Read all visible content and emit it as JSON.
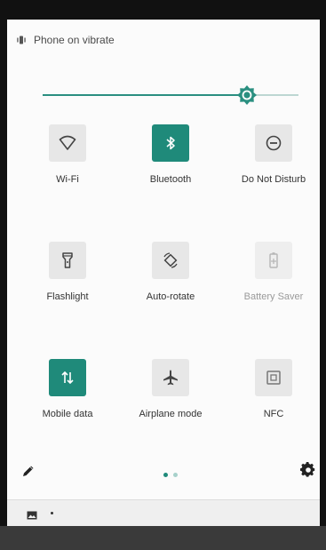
{
  "status": {
    "text": "Phone on vibrate",
    "icon": "vibrate-icon"
  },
  "brightness": {
    "level_fraction": 0.8
  },
  "tiles": [
    {
      "label": "Wi-Fi",
      "icon": "wifi-icon",
      "state": "off"
    },
    {
      "label": "Bluetooth",
      "icon": "bluetooth-icon",
      "state": "on"
    },
    {
      "label": "Do Not Disturb",
      "icon": "dnd-icon",
      "state": "off"
    },
    {
      "label": "Flashlight",
      "icon": "flashlight-icon",
      "state": "off"
    },
    {
      "label": "Auto-rotate",
      "icon": "auto-rotate-icon",
      "state": "off"
    },
    {
      "label": "Battery Saver",
      "icon": "battery-saver-icon",
      "state": "disabled"
    },
    {
      "label": "Mobile data",
      "icon": "mobile-data-icon",
      "state": "on"
    },
    {
      "label": "Airplane mode",
      "icon": "airplane-icon",
      "state": "off"
    },
    {
      "label": "NFC",
      "icon": "nfc-icon",
      "state": "off"
    }
  ],
  "pager": {
    "pages": 2,
    "current": 1
  },
  "colors": {
    "accent": "#1f8a7a",
    "tile_off": "#e7e7e7",
    "track_rest": "#bdd6d2"
  }
}
